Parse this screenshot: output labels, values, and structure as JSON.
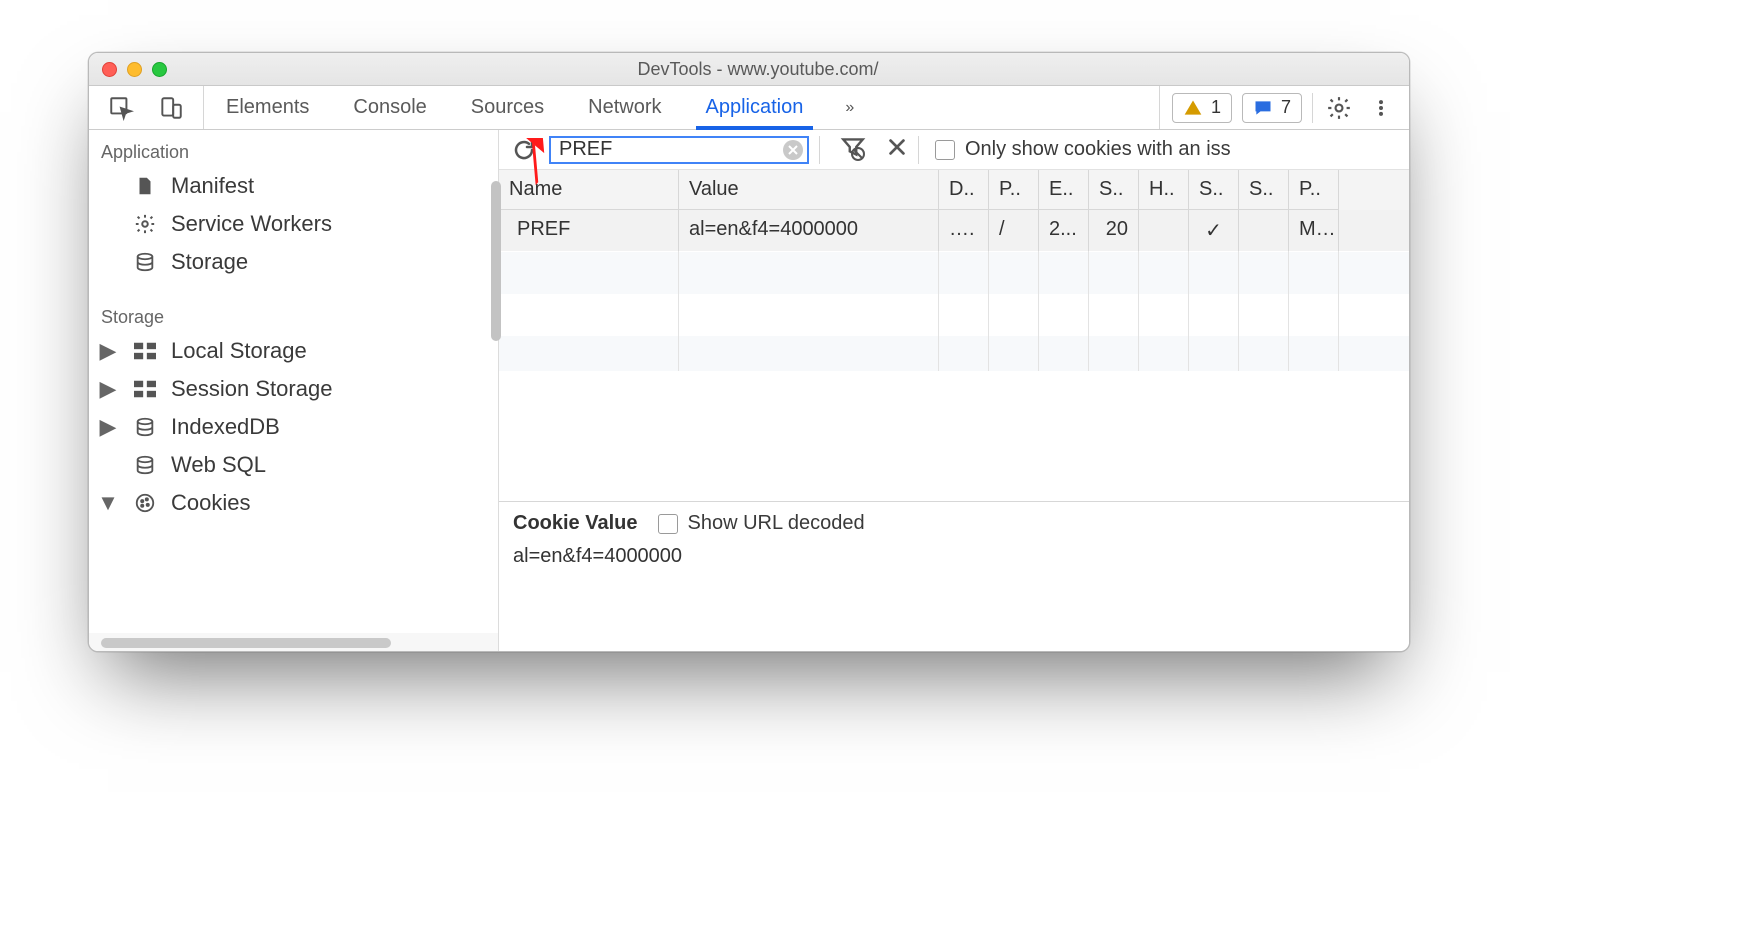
{
  "window": {
    "title": "DevTools - www.youtube.com/"
  },
  "toolbar": {
    "tabs": [
      {
        "label": "Elements",
        "active": false
      },
      {
        "label": "Console",
        "active": false
      },
      {
        "label": "Sources",
        "active": false
      },
      {
        "label": "Network",
        "active": false
      },
      {
        "label": "Application",
        "active": true
      }
    ],
    "more_indicator": "»",
    "warn_count": "1",
    "msg_count": "7"
  },
  "sidebar": {
    "sections": [
      {
        "title": "Application",
        "items": [
          {
            "icon": "document-icon",
            "label": "Manifest",
            "expandable": false
          },
          {
            "icon": "gear-icon",
            "label": "Service Workers",
            "expandable": false
          },
          {
            "icon": "database-icon",
            "label": "Storage",
            "expandable": false
          }
        ]
      },
      {
        "title": "Storage",
        "items": [
          {
            "icon": "grid-icon",
            "label": "Local Storage",
            "expandable": true
          },
          {
            "icon": "grid-icon",
            "label": "Session Storage",
            "expandable": true
          },
          {
            "icon": "database-icon",
            "label": "IndexedDB",
            "expandable": true
          },
          {
            "icon": "database-icon",
            "label": "Web SQL",
            "expandable": false
          },
          {
            "icon": "cookie-icon",
            "label": "Cookies",
            "expandable": true,
            "expanded": true
          }
        ]
      }
    ]
  },
  "cookies": {
    "filter_value": "PREF",
    "only_with_issues_label": "Only show cookies with an iss",
    "columns": [
      "Name",
      "Value",
      "D..",
      "P..",
      "E..",
      "S..",
      "H..",
      "S..",
      "S..",
      "P.."
    ],
    "rows": [
      {
        "name": "PREF",
        "value": "al=en&f4=4000000",
        "domain": "…. ",
        "path": "/",
        "expires": "2...",
        "size": "20",
        "httponly": "",
        "secure": "✓",
        "samesite": "",
        "priority": "M..."
      }
    ],
    "details": {
      "heading": "Cookie Value",
      "show_decoded_label": "Show URL decoded",
      "value": "al=en&f4=4000000"
    }
  }
}
